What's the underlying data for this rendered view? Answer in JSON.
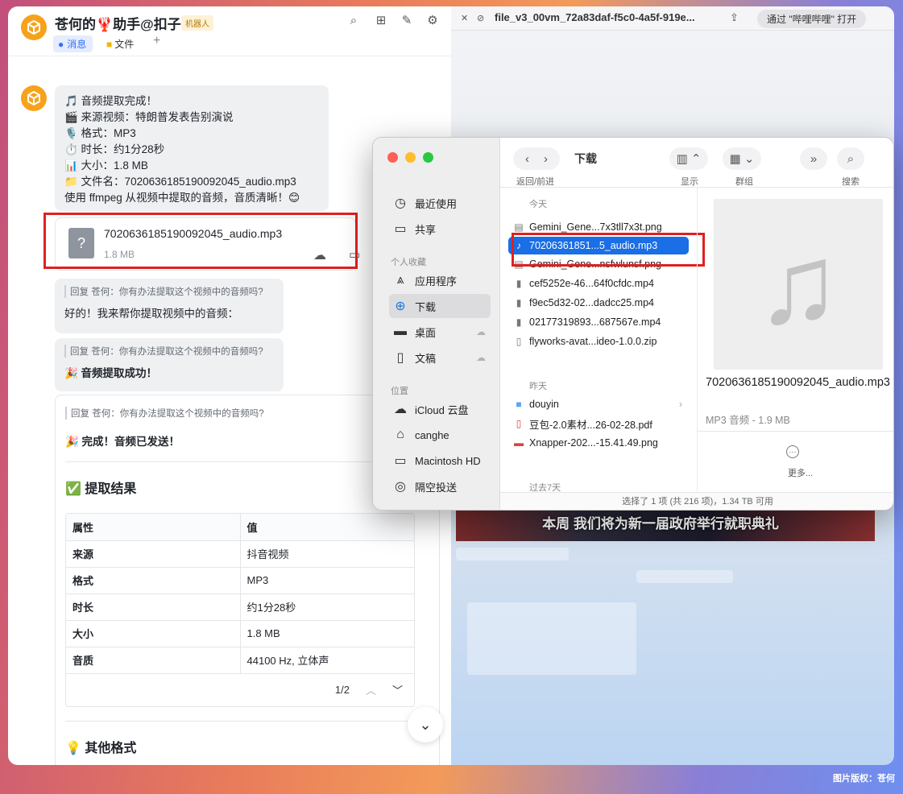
{
  "chat": {
    "title": "苍何的🦞助手@扣子",
    "badge": "机器人",
    "tabs": {
      "messages": "消息",
      "files": "文件",
      "add": "+"
    },
    "message_lines": [
      "🎵 音频提取完成！",
      "🎬 来源视频：特朗普发表告别演说",
      "🎙️ 格式：MP3",
      "⏱️ 时长：约1分28秒",
      "📊 大小：1.8 MB",
      "📁 文件名：7020636185190092045_audio.mp3",
      "使用 ffmpeg 从视频中提取的音频，音质清晰！😊"
    ],
    "file_card": {
      "name": "7020636185190092045_audio.mp3",
      "size": "1.8 MB"
    },
    "replies": [
      {
        "quote": "回复 苍何：你有办法提取这个视频中的音频吗?",
        "text": "好的！我来帮你提取视频中的音频："
      },
      {
        "quote": "回复 苍何：你有办法提取这个视频中的音频吗?",
        "text": "🎉 音频提取成功！"
      }
    ],
    "result_card": {
      "quote": "回复 苍何：你有办法提取这个视频中的音频吗?",
      "done": "🎉 完成！音频已发送！",
      "heading": "✅ 提取结果",
      "table_headers": [
        "属性",
        "值"
      ],
      "table_rows": [
        [
          "来源",
          "抖音视频"
        ],
        [
          "格式",
          "MP3"
        ],
        [
          "时长",
          "约1分28秒"
        ],
        [
          "大小",
          "1.8 MB"
        ],
        [
          "音质",
          "44100 Hz, 立体声"
        ]
      ],
      "pager": "1/2",
      "other_heading": "💡 其他格式"
    }
  },
  "browser": {
    "title": "file_v3_00vm_72a83daf-f5c0-4a5f-919e...",
    "open_button": "通过 \"哔哩哔哩\" 打开",
    "caption": "本周 我们将为新一届政府举行就职典礼"
  },
  "finder": {
    "title": "下载",
    "nav_label": "返回/前进",
    "toolbar_labels": {
      "view": "显示",
      "group": "群组",
      "search": "搜索"
    },
    "sidebar": {
      "top_items": [
        {
          "label": "最近使用",
          "icon": "clock-icon"
        },
        {
          "label": "共享",
          "icon": "shared-folder-icon"
        }
      ],
      "favorites_label": "个人收藏",
      "favorites": [
        {
          "label": "应用程序",
          "icon": "apps-icon"
        },
        {
          "label": "下载",
          "icon": "download-icon"
        },
        {
          "label": "桌面",
          "icon": "desktop-icon"
        },
        {
          "label": "文稿",
          "icon": "document-icon"
        }
      ],
      "locations_label": "位置",
      "locations": [
        {
          "label": "iCloud 云盘",
          "icon": "cloud-icon"
        },
        {
          "label": "canghe",
          "icon": "home-icon"
        },
        {
          "label": "Macintosh HD",
          "icon": "disk-icon"
        },
        {
          "label": "隔空投送",
          "icon": "airdrop-icon"
        }
      ]
    },
    "groups": {
      "today": "今天",
      "yesterday": "昨天",
      "past7": "过去7天"
    },
    "files_today": [
      "Gemini_Gene...7x3tll7x3t.png",
      "70206361851...5_audio.mp3",
      "Gemini_Gene...nsfwlunsf.png",
      "cef5252e-46...64f0cfdc.mp4",
      "f9ec5d32-02...dadcc25.mp4",
      "02177319893...687567e.mp4",
      "flyworks-avat...ideo-1.0.0.zip"
    ],
    "files_yesterday": [
      "douyin",
      "豆包-2.0素材...26-02-28.pdf",
      "Xnapper-202...-15.41.49.png"
    ],
    "preview": {
      "name": "7020636185190092045_audio.mp3",
      "meta": "MP3 音频 - 1.9 MB",
      "more": "更多..."
    },
    "status": "选择了 1 项 (共 216 项)，1.34 TB 可用"
  },
  "copyright": "图片版权：苍何",
  "colors": {
    "accent": "#1a6ee6",
    "highlight": "#e0201f",
    "bot": "#f7a21b"
  }
}
